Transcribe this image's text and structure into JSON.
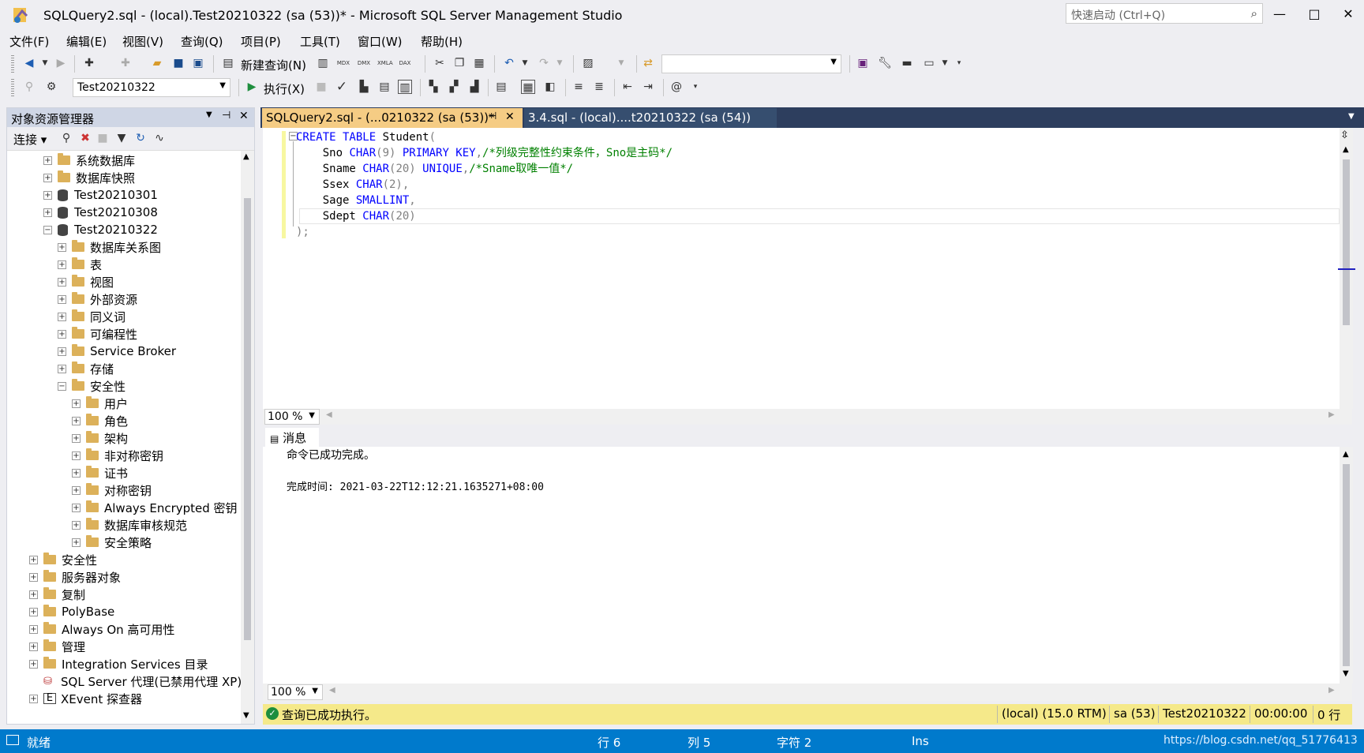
{
  "window": {
    "title": "SQLQuery2.sql - (local).Test20210322 (sa (53))* - Microsoft SQL Server Management Studio",
    "quicklaunch_placeholder": "快速启动 (Ctrl+Q)",
    "minimize": "—",
    "maximize": "□",
    "close": "✕"
  },
  "menu": [
    "文件(F)",
    "编辑(E)",
    "视图(V)",
    "查询(Q)",
    "项目(P)",
    "工具(T)",
    "窗口(W)",
    "帮助(H)"
  ],
  "toolbar": {
    "new_query": "新建查询(N)",
    "database": "Test20210322",
    "execute": "执行(X)",
    "mdx": "MDX",
    "dmx": "DMX",
    "xmla": "XMLA",
    "dax": "DAX"
  },
  "object_explorer": {
    "title": "对象资源管理器",
    "connect": "连接",
    "tree": [
      {
        "label": "系统数据库",
        "type": "folder",
        "level": 2,
        "exp": "+"
      },
      {
        "label": "数据库快照",
        "type": "folder",
        "level": 2,
        "exp": "+"
      },
      {
        "label": "Test20210301",
        "type": "db",
        "level": 2,
        "exp": "+"
      },
      {
        "label": "Test20210308",
        "type": "db",
        "level": 2,
        "exp": "+"
      },
      {
        "label": "Test20210322",
        "type": "db",
        "level": 2,
        "exp": "−"
      },
      {
        "label": "数据库关系图",
        "type": "folder",
        "level": 3,
        "exp": "+"
      },
      {
        "label": "表",
        "type": "folder",
        "level": 3,
        "exp": "+"
      },
      {
        "label": "视图",
        "type": "folder",
        "level": 3,
        "exp": "+"
      },
      {
        "label": "外部资源",
        "type": "folder",
        "level": 3,
        "exp": "+"
      },
      {
        "label": "同义词",
        "type": "folder",
        "level": 3,
        "exp": "+"
      },
      {
        "label": "可编程性",
        "type": "folder",
        "level": 3,
        "exp": "+"
      },
      {
        "label": "Service Broker",
        "type": "folder",
        "level": 3,
        "exp": "+"
      },
      {
        "label": "存储",
        "type": "folder",
        "level": 3,
        "exp": "+"
      },
      {
        "label": "安全性",
        "type": "folder",
        "level": 3,
        "exp": "−"
      },
      {
        "label": "用户",
        "type": "folder",
        "level": 4,
        "exp": "+"
      },
      {
        "label": "角色",
        "type": "folder",
        "level": 4,
        "exp": "+"
      },
      {
        "label": "架构",
        "type": "folder",
        "level": 4,
        "exp": "+"
      },
      {
        "label": "非对称密钥",
        "type": "folder",
        "level": 4,
        "exp": "+"
      },
      {
        "label": "证书",
        "type": "folder",
        "level": 4,
        "exp": "+"
      },
      {
        "label": "对称密钥",
        "type": "folder",
        "level": 4,
        "exp": "+"
      },
      {
        "label": "Always Encrypted 密钥",
        "type": "folder",
        "level": 4,
        "exp": "+"
      },
      {
        "label": "数据库审核规范",
        "type": "folder",
        "level": 4,
        "exp": "+"
      },
      {
        "label": "安全策略",
        "type": "folder",
        "level": 4,
        "exp": "+"
      },
      {
        "label": "安全性",
        "type": "folder",
        "level": 1,
        "exp": "+"
      },
      {
        "label": "服务器对象",
        "type": "folder",
        "level": 1,
        "exp": "+"
      },
      {
        "label": "复制",
        "type": "folder",
        "level": 1,
        "exp": "+"
      },
      {
        "label": "PolyBase",
        "type": "folder",
        "level": 1,
        "exp": "+"
      },
      {
        "label": "Always On 高可用性",
        "type": "folder",
        "level": 1,
        "exp": "+"
      },
      {
        "label": "管理",
        "type": "folder",
        "level": 1,
        "exp": "+"
      },
      {
        "label": "Integration Services 目录",
        "type": "folder",
        "level": 1,
        "exp": "+"
      },
      {
        "label": "SQL Server 代理(已禁用代理 XP)",
        "type": "agent",
        "level": 1,
        "exp": ""
      },
      {
        "label": "XEvent 探查器",
        "type": "xevent",
        "level": 1,
        "exp": "+"
      }
    ]
  },
  "tabs": {
    "active": "SQLQuery2.sql - (...0210322 (sa (53))*",
    "active_pin": "⊣",
    "active_close": "✕",
    "second": "3.4.sql - (local)....t20210322 (sa (54))"
  },
  "editor": {
    "lines": [
      [
        {
          "t": "CREATE TABLE ",
          "c": "kw"
        },
        {
          "t": "Student",
          "c": ""
        },
        {
          "t": "(",
          "c": "gr"
        }
      ],
      [
        {
          "t": "    Sno ",
          "c": ""
        },
        {
          "t": "CHAR",
          "c": "kw"
        },
        {
          "t": "(9) ",
          "c": "gr"
        },
        {
          "t": "PRIMARY KEY",
          "c": "kw"
        },
        {
          "t": ",",
          "c": "gr"
        },
        {
          "t": "/*列级完整性约束条件，Sno是主码*/",
          "c": "cm"
        }
      ],
      [
        {
          "t": "    Sname ",
          "c": ""
        },
        {
          "t": "CHAR",
          "c": "kw"
        },
        {
          "t": "(20) ",
          "c": "gr"
        },
        {
          "t": "UNIQUE",
          "c": "kw"
        },
        {
          "t": ",",
          "c": "gr"
        },
        {
          "t": "/*Sname取唯一值*/",
          "c": "cm"
        }
      ],
      [
        {
          "t": "    Ssex ",
          "c": ""
        },
        {
          "t": "CHAR",
          "c": "kw"
        },
        {
          "t": "(2),",
          "c": "gr"
        }
      ],
      [
        {
          "t": "    Sage ",
          "c": ""
        },
        {
          "t": "SMALLINT",
          "c": "kw"
        },
        {
          "t": ",",
          "c": "gr"
        }
      ],
      [
        {
          "t": "    Sdept ",
          "c": ""
        },
        {
          "t": "CHAR",
          "c": "kw"
        },
        {
          "t": "(20)",
          "c": "gr"
        }
      ],
      [
        {
          "t": ");",
          "c": "gr"
        }
      ]
    ],
    "zoom": "100 %"
  },
  "results": {
    "tab_label": "消息",
    "line1": "命令已成功完成。",
    "line2": "完成时间: 2021-03-22T12:12:21.1635271+08:00",
    "zoom": "100 %"
  },
  "query_status": {
    "message": "查询已成功执行。",
    "server": "(local) (15.0 RTM)",
    "user": "sa (53)",
    "database": "Test20210322",
    "time": "00:00:00",
    "rows": "0 行"
  },
  "statusbar": {
    "ready": "就绪",
    "line": "行 6",
    "col": "列 5",
    "char": "字符 2",
    "mode": "Ins",
    "watermark": "https://blog.csdn.net/qq_51776413"
  },
  "colors": {
    "accent": "#007acc",
    "active_tab": "#f5cc84",
    "status_strip": "#f5e98a"
  }
}
